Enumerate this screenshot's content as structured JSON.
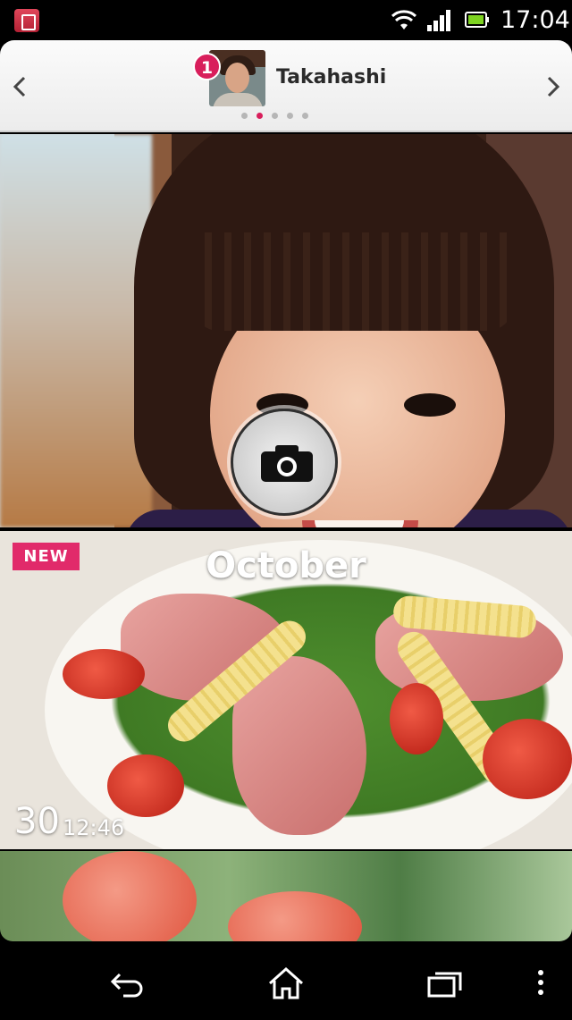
{
  "status_bar": {
    "time": "17:04",
    "icons": [
      "app-notification-icon",
      "wifi-icon",
      "signal-icon",
      "battery-icon"
    ]
  },
  "header": {
    "user_name": "Takahashi",
    "badge_count": "1",
    "page_count": 5,
    "active_page": 2
  },
  "hero": {
    "camera_icon": "camera-icon"
  },
  "tiles": [
    {
      "new_label": "NEW",
      "month": "October",
      "day": "30",
      "time": "12:46"
    }
  ],
  "nav_bar": {
    "icons": [
      "back-icon",
      "home-icon",
      "recent-apps-icon",
      "menu-icon"
    ]
  },
  "colors": {
    "accent": "#d81e5b",
    "new_badge": "#e12a6a"
  }
}
